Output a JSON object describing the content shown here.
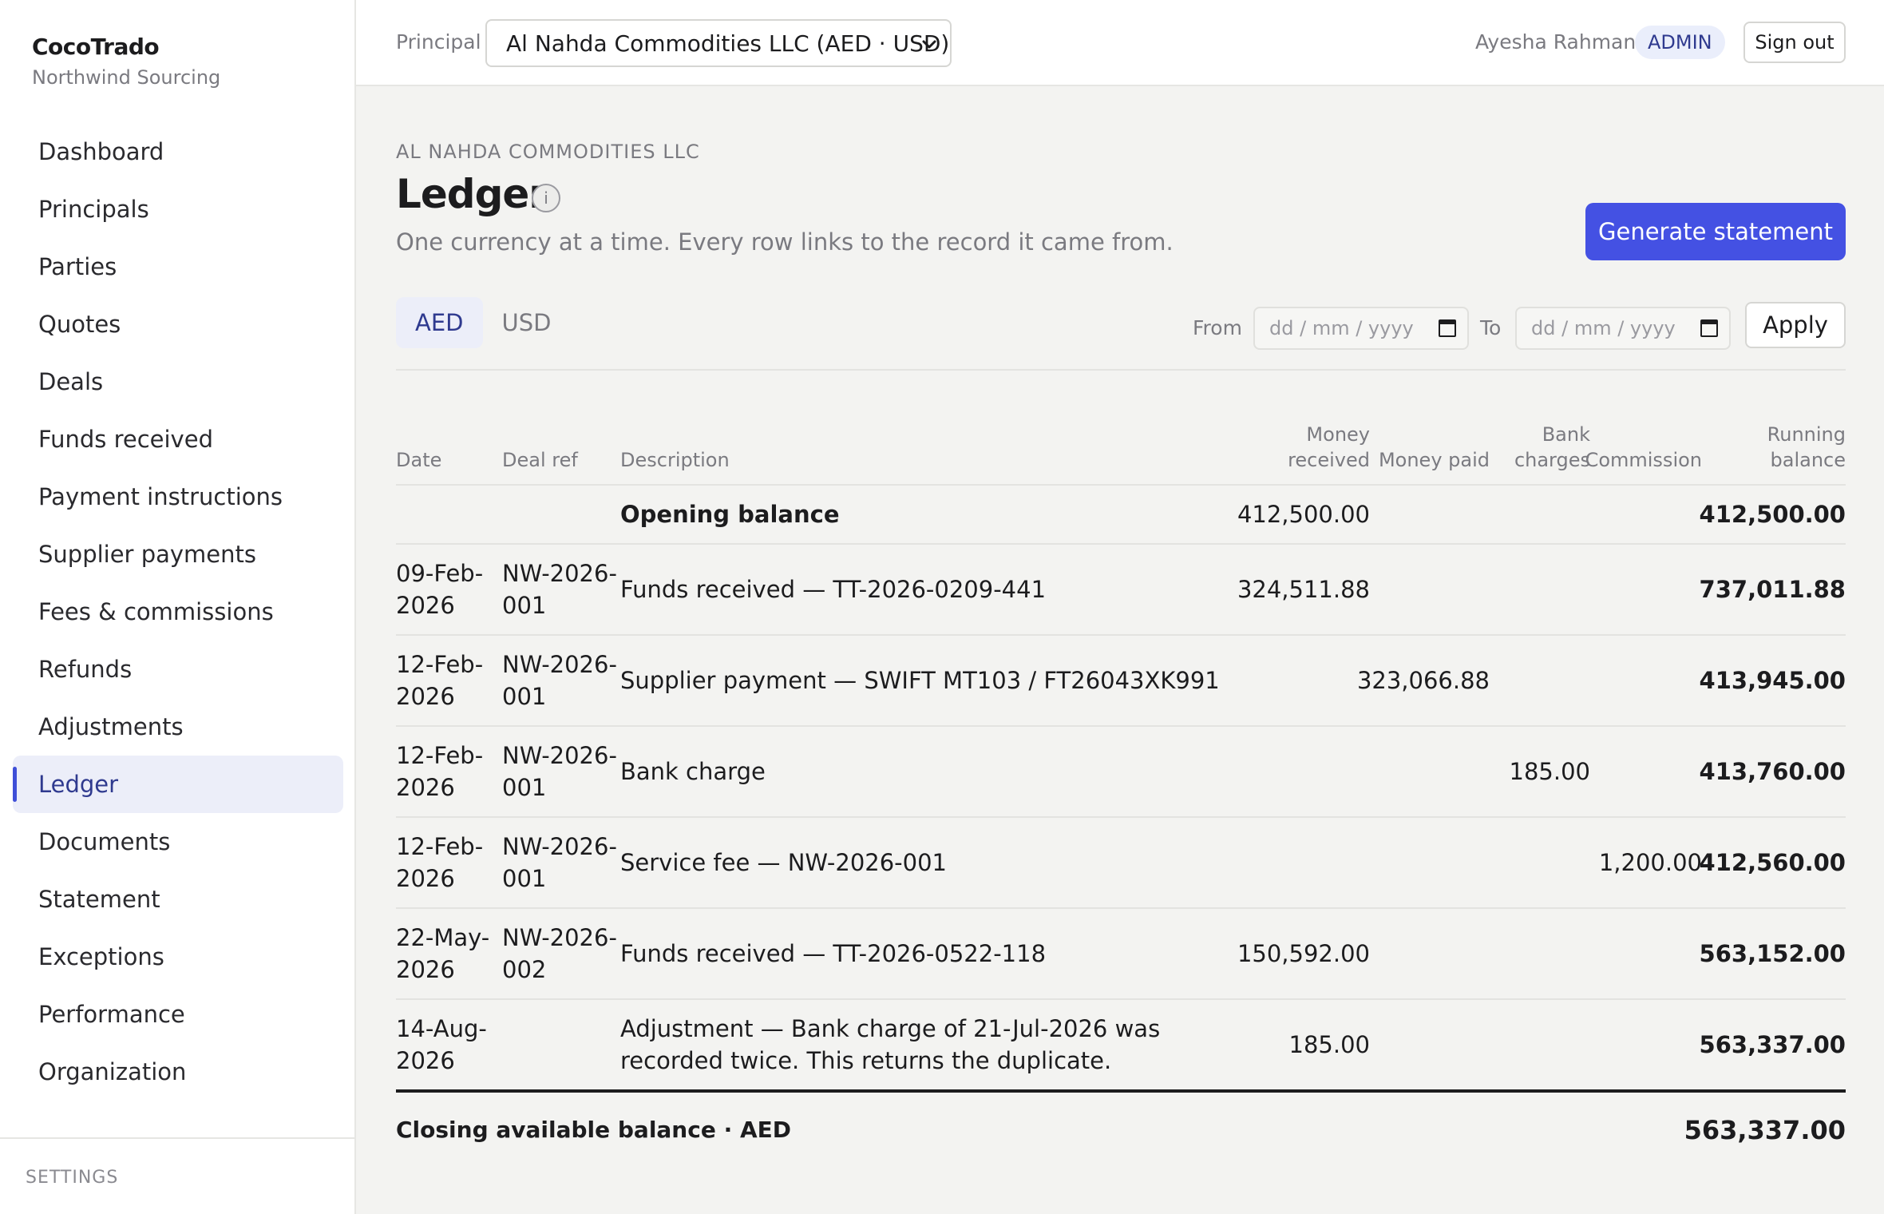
{
  "brand": {
    "name": "CocoTrado",
    "subtitle": "Northwind Sourcing"
  },
  "sidebar": {
    "items": [
      {
        "label": "Dashboard"
      },
      {
        "label": "Principals"
      },
      {
        "label": "Parties"
      },
      {
        "label": "Quotes"
      },
      {
        "label": "Deals"
      },
      {
        "label": "Funds received"
      },
      {
        "label": "Payment instructions"
      },
      {
        "label": "Supplier payments"
      },
      {
        "label": "Fees & commissions"
      },
      {
        "label": "Refunds"
      },
      {
        "label": "Adjustments"
      },
      {
        "label": "Ledger"
      },
      {
        "label": "Documents"
      },
      {
        "label": "Statement"
      },
      {
        "label": "Exceptions"
      },
      {
        "label": "Performance"
      },
      {
        "label": "Organization"
      }
    ],
    "active_item": "Ledger",
    "settings_label": "SETTINGS"
  },
  "topbar": {
    "principal_label": "Principal",
    "principal_selected": "Al Nahda Commodities LLC (AED · USD)",
    "user_name": "Ayesha Rahman",
    "role": "ADMIN",
    "signout_label": "Sign out"
  },
  "page": {
    "eyebrow": "AL NAHDA COMMODITIES LLC",
    "title": "Ledger",
    "subtitle": "One currency at a time. Every row links to the record it came from.",
    "generate_label": "Generate statement"
  },
  "filters": {
    "tabs": [
      "AED",
      "USD"
    ],
    "active_tab": "AED",
    "from_label": "From",
    "to_label": "To",
    "date_placeholder": "dd / mm / yyyy",
    "apply_label": "Apply"
  },
  "ledger": {
    "headers": {
      "date": "Date",
      "deal_ref": "Deal ref",
      "description": "Description",
      "money_received": "Money received",
      "money_paid": "Money paid",
      "bank_charges": "Bank charges",
      "commission": "Commission",
      "running_balance": "Running balance"
    },
    "rows": [
      {
        "date": "",
        "deal_ref": "",
        "description": "Opening balance",
        "money_received": "412,500.00",
        "money_paid": "",
        "bank_charges": "",
        "commission": "",
        "running_balance": "412,500.00"
      },
      {
        "date": "09-Feb-2026",
        "deal_ref": "NW-2026-001",
        "description": "Funds received — TT-2026-0209-441",
        "money_received": "324,511.88",
        "money_paid": "",
        "bank_charges": "",
        "commission": "",
        "running_balance": "737,011.88"
      },
      {
        "date": "12-Feb-2026",
        "deal_ref": "NW-2026-001",
        "description": "Supplier payment — SWIFT MT103 / FT26043XK991",
        "money_received": "",
        "money_paid": "323,066.88",
        "bank_charges": "",
        "commission": "",
        "running_balance": "413,945.00"
      },
      {
        "date": "12-Feb-2026",
        "deal_ref": "NW-2026-001",
        "description": "Bank charge",
        "money_received": "",
        "money_paid": "",
        "bank_charges": "185.00",
        "commission": "",
        "running_balance": "413,760.00"
      },
      {
        "date": "12-Feb-2026",
        "deal_ref": "NW-2026-001",
        "description": "Service fee — NW-2026-001",
        "money_received": "",
        "money_paid": "",
        "bank_charges": "",
        "commission": "1,200.00",
        "running_balance": "412,560.00"
      },
      {
        "date": "22-May-2026",
        "deal_ref": "NW-2026-002",
        "description": "Funds received — TT-2026-0522-118",
        "money_received": "150,592.00",
        "money_paid": "",
        "bank_charges": "",
        "commission": "",
        "running_balance": "563,152.00"
      },
      {
        "date": "14-Aug-2026",
        "deal_ref": "",
        "description": "Adjustment — Bank charge of 21-Jul-2026 was recorded twice. This returns the duplicate.",
        "money_received": "185.00",
        "money_paid": "",
        "bank_charges": "",
        "commission": "",
        "running_balance": "563,337.00"
      }
    ],
    "closing_label": "Closing available balance · AED",
    "closing_value": "563,337.00"
  },
  "colors": {
    "accent": "#4451e3",
    "active_bg": "#eceef9",
    "background": "#f3f3f1"
  }
}
